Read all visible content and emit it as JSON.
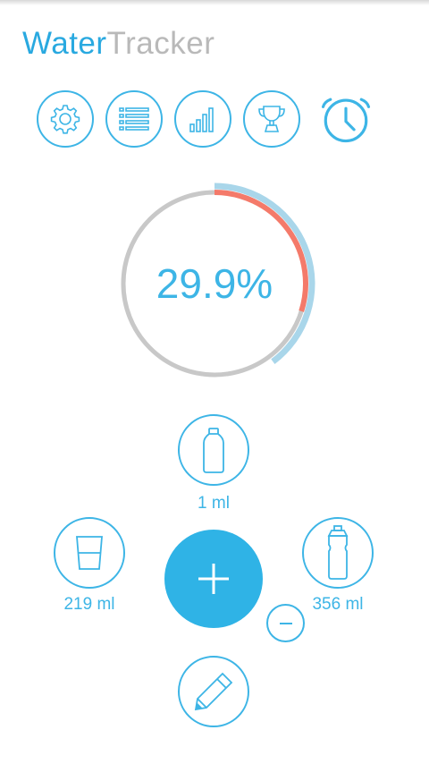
{
  "app": {
    "title_part1": "Water",
    "title_part2": "Tracker"
  },
  "toolbar": {
    "items": [
      {
        "icon": "gear-icon"
      },
      {
        "icon": "list-icon"
      },
      {
        "icon": "bar-chart-icon"
      },
      {
        "icon": "trophy-icon"
      },
      {
        "icon": "alarm-clock-icon"
      }
    ]
  },
  "progress": {
    "label": "29.9%",
    "value_fraction": 0.299,
    "colors": {
      "track": "#c8c8c8",
      "progress": "#f47a6a",
      "secondary": "#a9d6ea",
      "accent": "#3db5e6"
    }
  },
  "drinks": {
    "top": {
      "label": "1 ml",
      "icon": "bottle-icon"
    },
    "left": {
      "label": "219 ml",
      "icon": "glass-icon"
    },
    "right": {
      "label": "356 ml",
      "icon": "sports-bottle-icon"
    }
  },
  "actions": {
    "add_icon": "plus-icon",
    "remove_icon": "minus-icon",
    "edit_icon": "pencil-icon"
  }
}
